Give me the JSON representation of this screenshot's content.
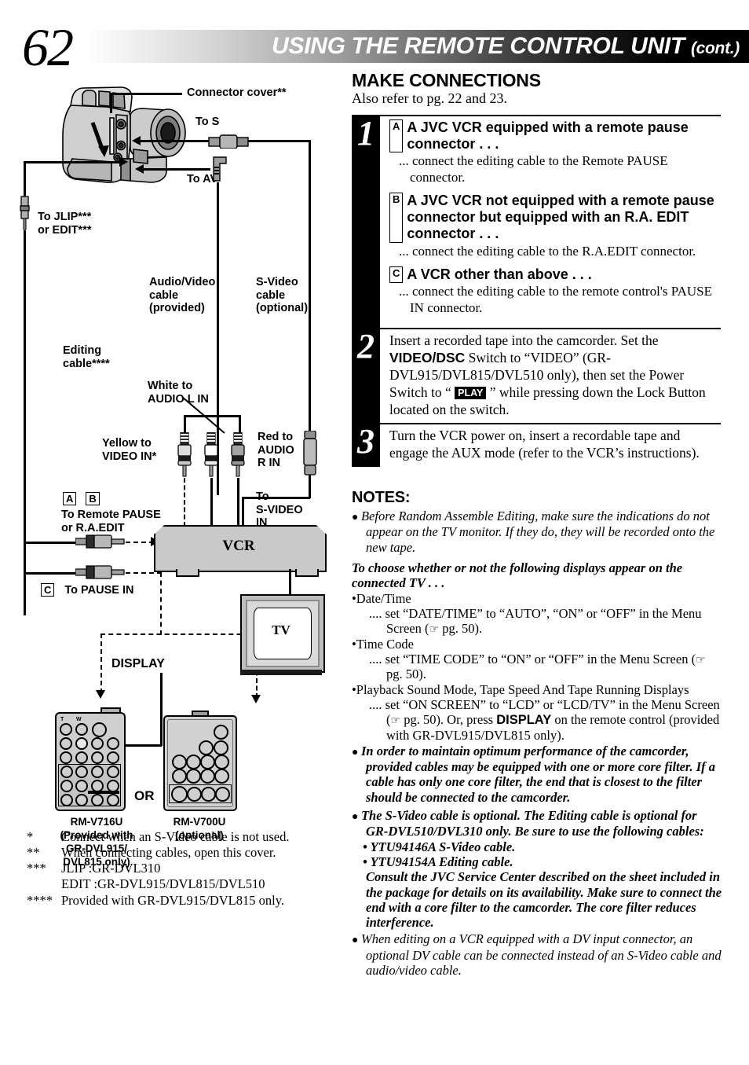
{
  "header": {
    "page_number": "62",
    "title": "USING THE REMOTE CONTROL UNIT",
    "cont": "(cont.)"
  },
  "section": {
    "title": "MAKE CONNECTIONS",
    "subtitle": "Also refer to pg. 22 and 23."
  },
  "steps": [
    {
      "number": "1",
      "options": [
        {
          "tag": "A",
          "heading": "A JVC VCR equipped with a remote pause connector . . .",
          "body": "... connect the editing cable to the Remote PAUSE connector."
        },
        {
          "tag": "B",
          "heading": "A JVC VCR not equipped with a remote pause connector but equipped with an R.A. EDIT connector . . .",
          "body": "... connect the editing cable to the R.A.EDIT connector."
        },
        {
          "tag": "C",
          "heading": "A VCR other than above . . .",
          "body": "... connect the editing cable to the remote control's PAUSE IN connector."
        }
      ]
    },
    {
      "number": "2",
      "text_parts": {
        "p1": "Insert a recorded tape into the camcorder. Set the ",
        "bold1": "VIDEO/DSC",
        "p2": " Switch to “VIDEO” (GR-DVL915/DVL815/DVL510 only), then set the Power Switch to “ ",
        "play": "PLAY",
        "p3": " ” while pressing down the Lock Button located on the switch."
      }
    },
    {
      "number": "3",
      "text": "Turn the VCR power on, insert a recordable tape and engage the AUX mode (refer to the VCR’s instructions)."
    }
  ],
  "notes": {
    "heading": "NOTES:",
    "items": [
      {
        "style": "italic",
        "text": "Before Random Assemble Editing, make sure the indications do not appear on the TV monitor. If they do, they will be recorded onto the new tape."
      }
    ],
    "displays_heading": "To choose whether or not the following displays appear on the connected TV . . .",
    "display_items": [
      {
        "label": "Date/Time",
        "detail": ".... set “DATE/TIME” to “AUTO”, “ON” or “OFF” in the Menu Screen (",
        "detail_end": " pg. 50)."
      },
      {
        "label": "Time Code",
        "detail": ".... set “TIME CODE” to “ON” or “OFF” in the Menu Screen (",
        "detail_end": " pg. 50)."
      },
      {
        "label": "Playback Sound Mode, Tape Speed And Tape Running Displays",
        "detail": ".... set “ON SCREEN” to “LCD” or “LCD/TV” in the Menu Screen (",
        "detail_end": " pg. 50). Or, press ",
        "bold": "DISPLAY",
        "detail_tail": " on the remote control (provided with GR-DVL915/DVL815 only)."
      }
    ],
    "core_filter_note": "In order to maintain optimum performance of the camcorder, provided cables may be equipped with one or more core filter. If a cable has only one core filter, the end that is closest to the filter should be connected to the camcorder.",
    "svideo_note": "The S-Video cable is optional. The Editing cable is optional for GR-DVL510/DVL310 only. Be sure to use the following cables:",
    "cable_list": [
      "• YTU94146A S-Video cable.",
      "• YTU94154A Editing cable."
    ],
    "consult_note": "Consult the JVC Service Center described on the sheet included in the package for details on its availability. Make sure to connect the end with a core filter to the camcorder. The core filter reduces interference.",
    "dv_note": "When editing on a VCR equipped with a DV input connector, an optional DV cable can be connected instead of an S-Video cable and audio/video cable."
  },
  "diagram": {
    "labels": {
      "connector_cover": "Connector cover**",
      "to_s": "To S",
      "to_av": "To AV",
      "to_jlip": "To JLIP***\nor EDIT***",
      "av_cable": "Audio/Video\ncable\n(provided)",
      "svideo_cable": "S-Video\ncable\n(optional)",
      "editing_cable": "Editing\ncable****",
      "white_to": "White to\nAUDIO L IN",
      "yellow_to": "Yellow to\nVIDEO IN*",
      "red_to": "Red to\nAUDIO\nR IN",
      "to_svideo_in": "To\nS-VIDEO\nIN",
      "to_remote_pause": "To Remote PAUSE\nor R.A.EDIT",
      "to_pause_in": "To PAUSE IN",
      "display": "DISPLAY",
      "vcr": "VCR",
      "tv": "TV",
      "or": "OR",
      "tag_a": "A",
      "tag_b": "B",
      "tag_c": "C",
      "remote1": "RM-V716U\n(Provided with\nGR-DVL915/\nDVL815 only)",
      "remote2": "RM-V700U\n(optional)",
      "rem_t": "T",
      "rem_w": "W"
    }
  },
  "footnotes": [
    {
      "mark": "*",
      "text": "Connect when an S-Video cable is not used."
    },
    {
      "mark": "**",
      "text": "When connecting cables, open this cover."
    },
    {
      "mark": "***",
      "text": "JLIP   :GR-DVL310"
    },
    {
      "mark": "",
      "text": "EDIT :GR-DVL915/DVL815/DVL510"
    },
    {
      "mark": "****",
      "text": "Provided with GR-DVL915/DVL815 only."
    }
  ]
}
